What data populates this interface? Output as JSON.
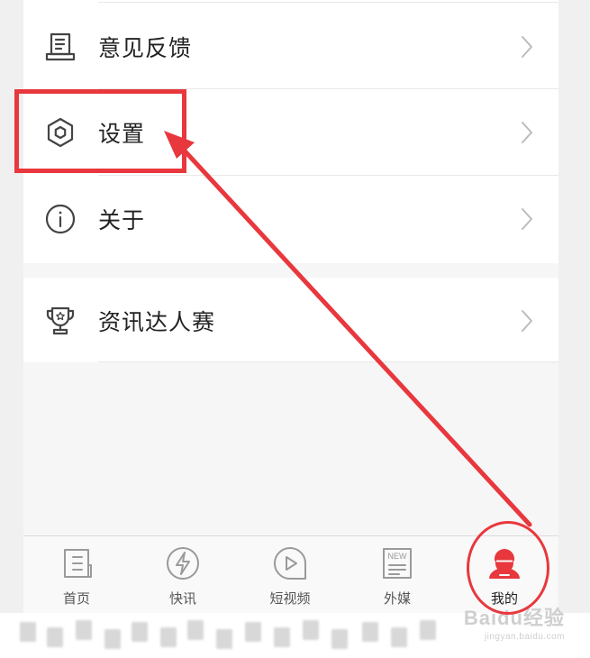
{
  "menu": {
    "items": [
      {
        "label": "意见反馈",
        "icon": "feedback-icon"
      },
      {
        "label": "设置",
        "icon": "settings-hexagon-icon"
      },
      {
        "label": "关于",
        "icon": "info-icon"
      }
    ],
    "extra_items": [
      {
        "label": "资讯达人赛",
        "icon": "trophy-icon"
      }
    ]
  },
  "tabbar": {
    "tabs": [
      {
        "label": "首页",
        "icon": "home-news-icon"
      },
      {
        "label": "快讯",
        "icon": "flash-icon"
      },
      {
        "label": "短视频",
        "icon": "play-icon"
      },
      {
        "label": "外媒",
        "icon": "new-paper-icon",
        "badge": "NEW"
      },
      {
        "label": "我的",
        "icon": "profile-icon",
        "active": true
      }
    ]
  },
  "watermark": {
    "main": "Baidu经验",
    "sub": "jingyan.baidu.com"
  },
  "colors": {
    "accent": "#e8383d",
    "active_tab": "#e8383d",
    "icon_gray": "#9a9a9a",
    "text": "#222222"
  }
}
